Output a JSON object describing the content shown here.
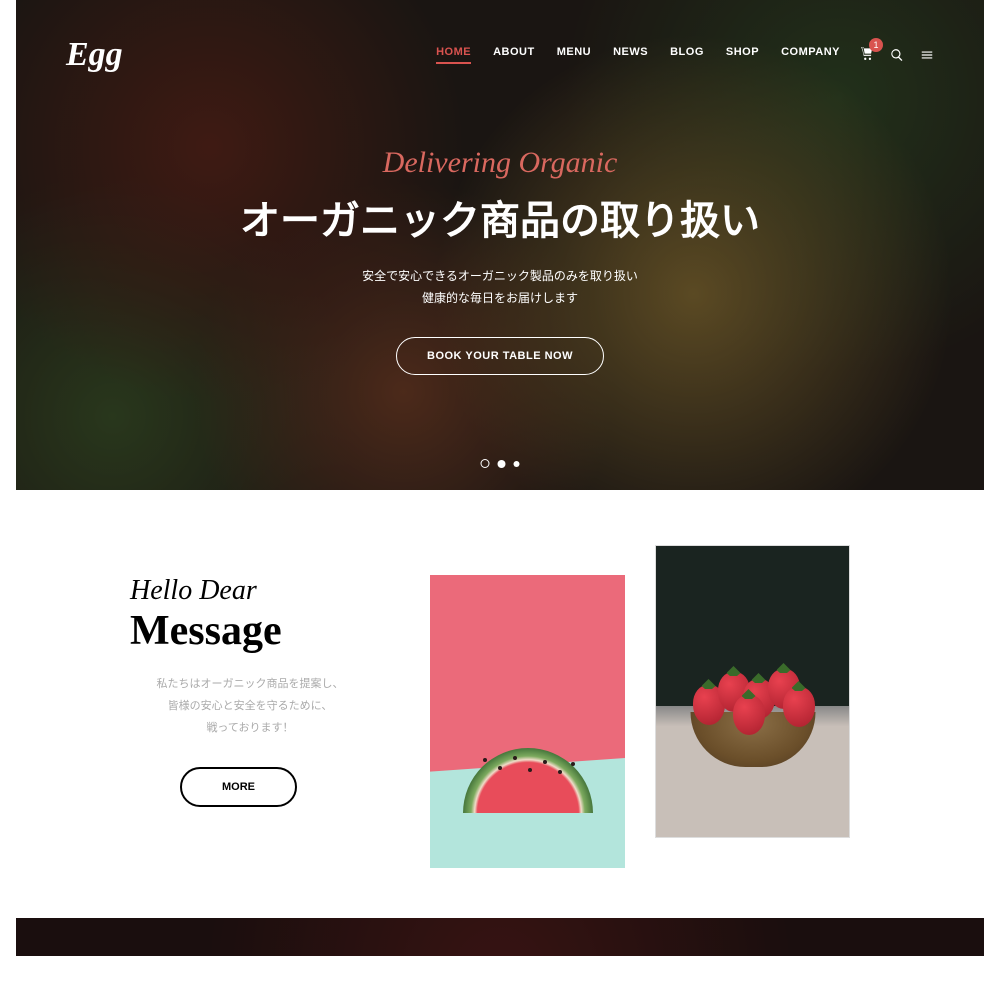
{
  "brand": "Egg",
  "nav": {
    "items": [
      "HOME",
      "ABOUT",
      "MENU",
      "NEWS",
      "BLOG",
      "SHOP",
      "COMPANY"
    ],
    "activeIndex": 0,
    "cartBadge": "1"
  },
  "hero": {
    "script": "Delivering Organic",
    "title": "オーガニック商品の取り扱い",
    "subtitle1": "安全で安心できるオーガニック製品のみを取り扱い",
    "subtitle2": "健康的な毎日をお届けします",
    "cta": "BOOK YOUR TABLE NOW"
  },
  "message": {
    "script": "Hello Dear",
    "title": "Message",
    "body1": "私たちはオーガニック商品を提案し、",
    "body2": "皆様の安心と安全を守るために、",
    "body3": "戦っております！",
    "cta": "MORE"
  },
  "colors": {
    "accent": "#d9534f"
  }
}
